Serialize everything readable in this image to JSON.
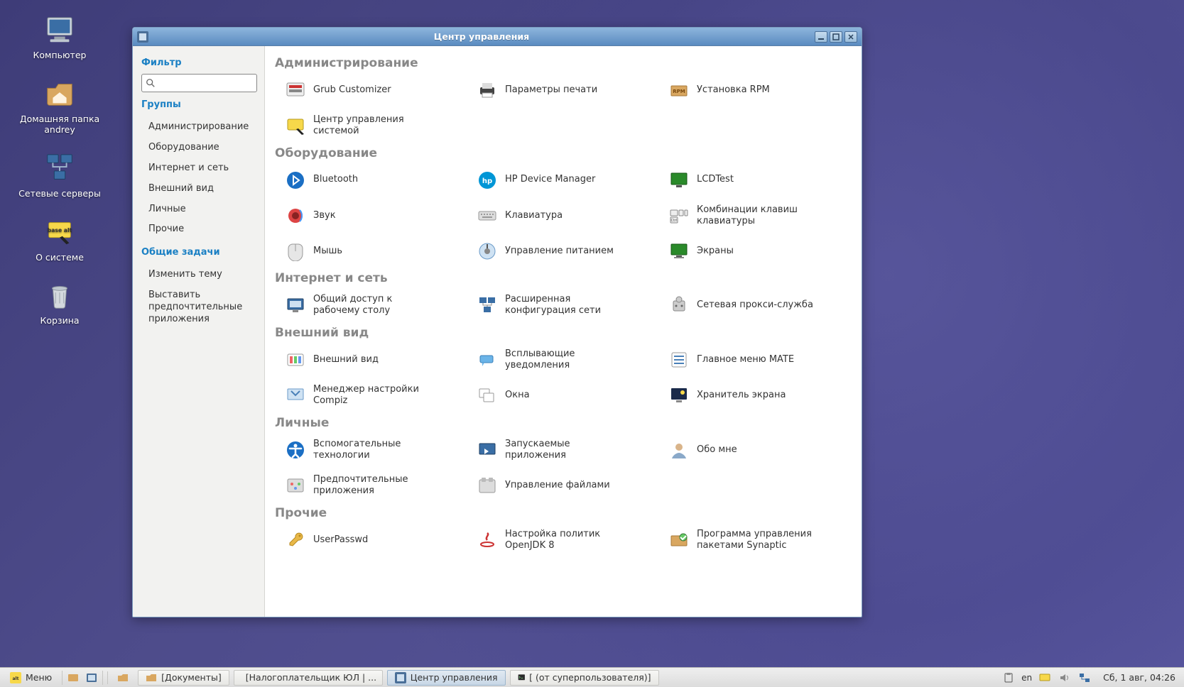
{
  "desktop": {
    "icons": [
      {
        "id": "computer",
        "label": "Компьютер"
      },
      {
        "id": "home",
        "label": "Домашняя папка\nandrey"
      },
      {
        "id": "network",
        "label": "Сетевые серверы"
      },
      {
        "id": "about",
        "label": "О системе"
      },
      {
        "id": "trash",
        "label": "Корзина"
      }
    ]
  },
  "window": {
    "title": "Центр управления",
    "sidebar": {
      "filter_label": "Фильтр",
      "search_placeholder": "",
      "groups_label": "Группы",
      "groups": [
        "Администрирование",
        "Оборудование",
        "Интернет и сеть",
        "Внешний вид",
        "Личные",
        "Прочие"
      ],
      "tasks_label": "Общие задачи",
      "tasks": [
        "Изменить тему",
        "Выставить предпочтительные приложения"
      ]
    },
    "categories": [
      {
        "id": "admin",
        "title": "Администрирование",
        "items": [
          {
            "id": "grub-customizer",
            "label": "Grub Customizer",
            "icon": "grub"
          },
          {
            "id": "print-params",
            "label": "Параметры печати",
            "icon": "printer"
          },
          {
            "id": "rpm-install",
            "label": "Установка RPM",
            "icon": "rpm"
          },
          {
            "id": "system-control-center",
            "label": "Центр управления системой",
            "icon": "basealt"
          }
        ]
      },
      {
        "id": "hardware",
        "title": "Оборудование",
        "items": [
          {
            "id": "bluetooth",
            "label": "Bluetooth",
            "icon": "bluetooth"
          },
          {
            "id": "hp-device-manager",
            "label": "HP Device Manager",
            "icon": "hp"
          },
          {
            "id": "lcdtest",
            "label": "LCDTest",
            "icon": "lcd"
          },
          {
            "id": "sound",
            "label": "Звук",
            "icon": "sound"
          },
          {
            "id": "keyboard",
            "label": "Клавиатура",
            "icon": "keyboard"
          },
          {
            "id": "keyboard-shortcuts",
            "label": "Комбинации клавиш клавиатуры",
            "icon": "shortcuts"
          },
          {
            "id": "mouse",
            "label": "Мышь",
            "icon": "mouse"
          },
          {
            "id": "power-mgmt",
            "label": "Управление питанием",
            "icon": "power"
          },
          {
            "id": "screens",
            "label": "Экраны",
            "icon": "display"
          }
        ]
      },
      {
        "id": "network",
        "title": "Интернет и сеть",
        "items": [
          {
            "id": "desktop-sharing",
            "label": "Общий доступ к рабочему столу",
            "icon": "share"
          },
          {
            "id": "advanced-network",
            "label": "Расширенная конфигурация сети",
            "icon": "netconf"
          },
          {
            "id": "proxy",
            "label": "Сетевая прокси-служба",
            "icon": "proxy"
          }
        ]
      },
      {
        "id": "appearance",
        "title": "Внешний вид",
        "items": [
          {
            "id": "appearance",
            "label": "Внешний вид",
            "icon": "theme"
          },
          {
            "id": "popups",
            "label": "Всплывающие уведомления",
            "icon": "notify"
          },
          {
            "id": "mate-main-menu",
            "label": "Главное меню MATE",
            "icon": "menu"
          },
          {
            "id": "compiz",
            "label": "Менеджер настройки Compiz",
            "icon": "compiz"
          },
          {
            "id": "windows",
            "label": "Окна",
            "icon": "windows"
          },
          {
            "id": "screensaver",
            "label": "Хранитель экрана",
            "icon": "saver"
          }
        ]
      },
      {
        "id": "personal",
        "title": "Личные",
        "items": [
          {
            "id": "a11y",
            "label": "Вспомогательные технологии",
            "icon": "a11y"
          },
          {
            "id": "startup-apps",
            "label": "Запускаемые приложения",
            "icon": "startup"
          },
          {
            "id": "about-me",
            "label": "Обо мне",
            "icon": "user"
          },
          {
            "id": "preferred-apps",
            "label": "Предпочтительные приложения",
            "icon": "prefapp"
          },
          {
            "id": "file-mgmt",
            "label": "Управление файлами",
            "icon": "files"
          }
        ]
      },
      {
        "id": "other",
        "title": "Прочие",
        "items": [
          {
            "id": "userpasswd",
            "label": "UserPasswd",
            "icon": "keys"
          },
          {
            "id": "openjdk",
            "label": "Настройка политик OpenJDK 8",
            "icon": "java"
          },
          {
            "id": "synaptic",
            "label": "Программа управления пакетами Synaptic",
            "icon": "synaptic"
          }
        ]
      }
    ]
  },
  "taskbar": {
    "menu_label": "Меню",
    "quicklaunch": [
      "show-desktop",
      "file-manager",
      "control-center"
    ],
    "tasks": [
      {
        "id": "documents",
        "label": "[Документы]",
        "icon": "folder",
        "active": false
      },
      {
        "id": "taxpayer",
        "label": "[Налогоплательщик ЮЛ | ...",
        "icon": "firefox",
        "active": false
      },
      {
        "id": "control-center",
        "label": "Центр управления",
        "icon": "control",
        "active": true
      },
      {
        "id": "root-term",
        "label": "[ (от суперпользователя)]",
        "icon": "terminal",
        "active": false
      }
    ],
    "tray": {
      "keyboard": "en",
      "clock": "Сб, 1 авг, 04:26"
    }
  }
}
